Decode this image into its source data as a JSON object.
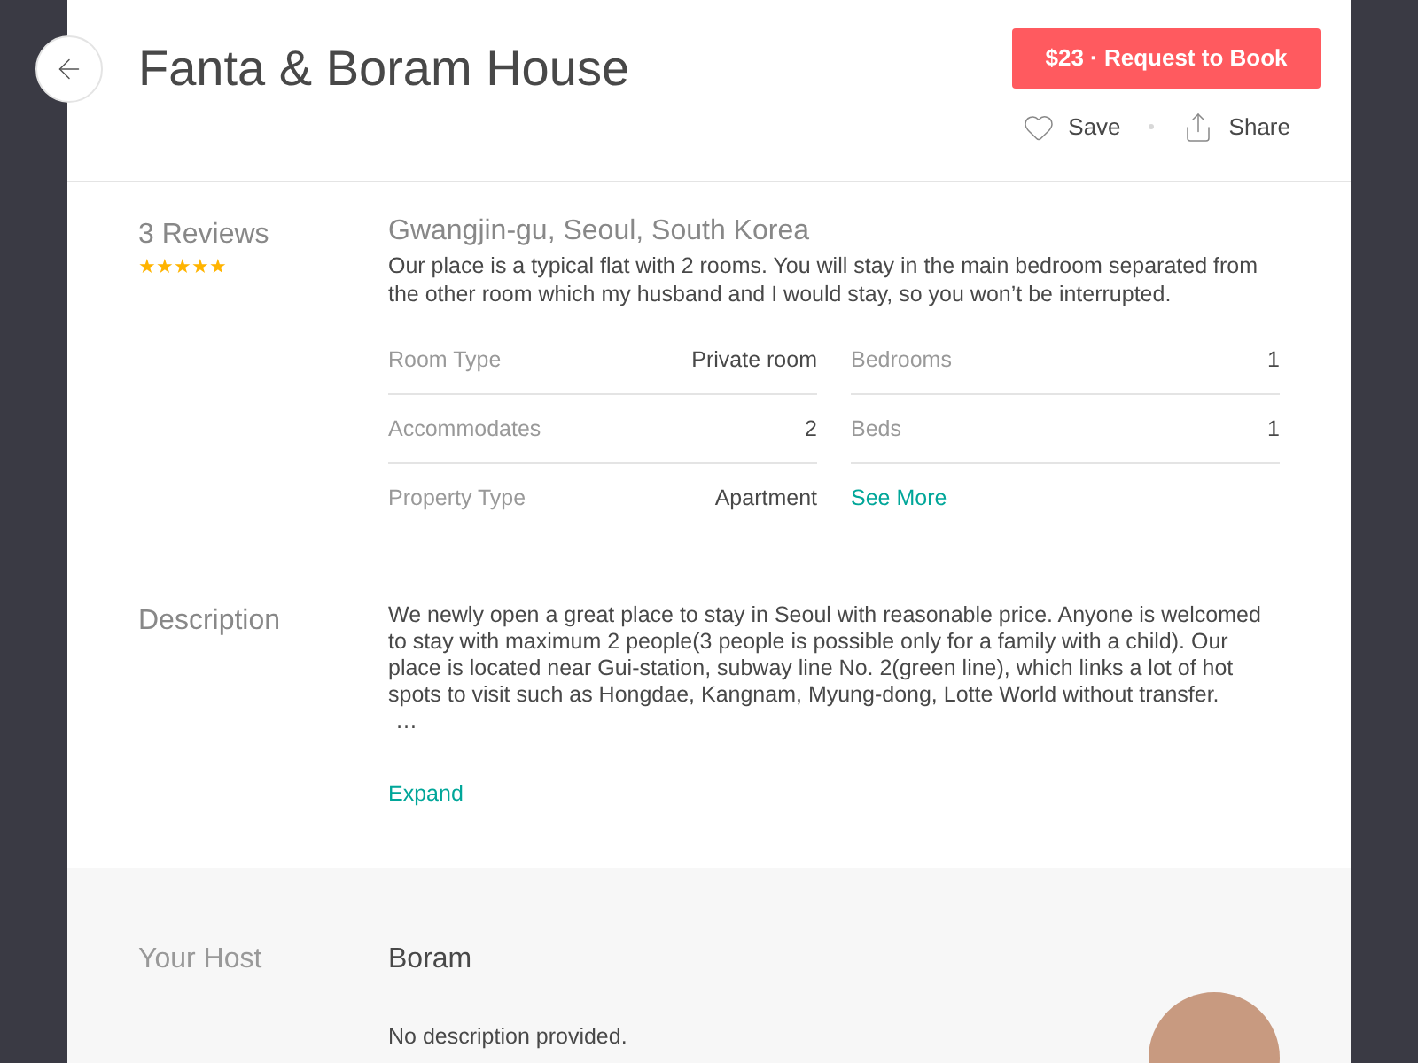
{
  "header": {
    "title": "Fanta & Boram House",
    "book_button": "$23 · Request to Book",
    "actions": [
      {
        "kind": "save",
        "label": "Save"
      },
      {
        "kind": "share",
        "label": "Share"
      }
    ]
  },
  "overview": {
    "reviews": "3 Reviews",
    "stars": 5,
    "location": "Gwangjin-gu, Seoul, South Korea",
    "summary": "Our place is a typical flat with 2 rooms. You will stay in the main bedroom separated from the other room which my husband and I would stay, so you won’t be interrupted.",
    "details": [
      {
        "kind": "pair",
        "label": "Room Type",
        "value": "Private room"
      },
      {
        "kind": "pair",
        "label": "Bedrooms",
        "value": "1"
      },
      {
        "kind": "pair",
        "label": "Accommodates",
        "value": "2"
      },
      {
        "kind": "pair",
        "label": "Beds",
        "value": "1"
      },
      {
        "kind": "pair",
        "label": "Property Type",
        "value": "Apartment"
      },
      {
        "kind": "link",
        "label": "See More"
      }
    ]
  },
  "description": {
    "heading": "Description",
    "text": "We newly open a great place to stay in Seoul with reasonable price. Anyone is welcomed to stay with maximum 2 people(3 people is possible only for a family with a child). Our place is located near Gui-station, subway line No. 2(green line), which links a lot of hot spots to visit such as Hongdae, Kangnam, Myung-dong, Lotte World without transfer.",
    "ellipsis": "…",
    "expand": "Expand"
  },
  "host": {
    "heading": "Your Host",
    "name": "Boram",
    "text": "No description provided."
  }
}
